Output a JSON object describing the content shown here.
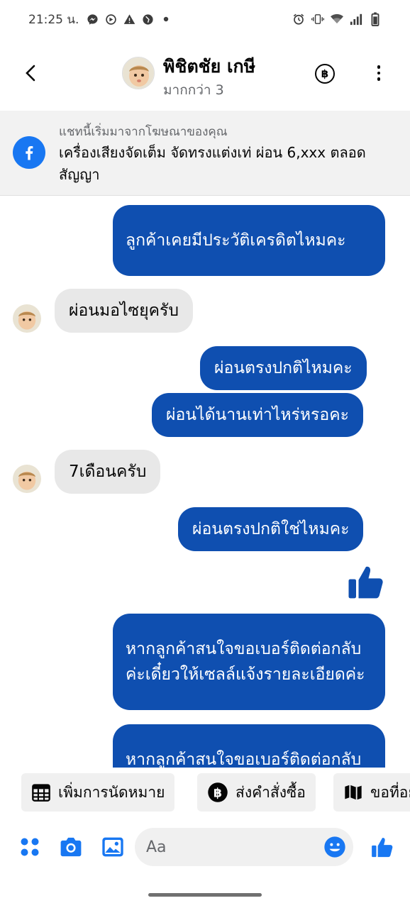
{
  "status_bar": {
    "time": "21:25 น.",
    "left_icons": [
      "messenger-icon",
      "compass-icon",
      "warning-icon",
      "globe-icon",
      "dot-icon"
    ],
    "right_icons": [
      "alarm-icon",
      "vibrate-icon",
      "wifi-icon",
      "signal-icon",
      "battery-icon"
    ]
  },
  "header": {
    "contact_name": "พิชิตชัย เกษี",
    "subtitle": "มากกว่า 3",
    "payment_symbol": "฿"
  },
  "ad_banner": {
    "caption": "แชทนี้เริ่มมาจากโฆษณาของคุณ",
    "ad_text": "เครื่องเสียงจัดเต็ม จัดทรงแต่งเท่ ผ่อน 6,xxx ตลอดสัญญา"
  },
  "messages": [
    {
      "from": "me",
      "text": "ลูกค้าเคยมีประวัติเครดิตไหมคะ"
    },
    {
      "from": "them",
      "text": "ผ่อนมอไซยุครับ"
    },
    {
      "from": "me",
      "text": "ผ่อนตรงปกติไหมคะ"
    },
    {
      "from": "me",
      "text": "ผ่อนได้นานเท่าไหร่หรอคะ"
    },
    {
      "from": "them",
      "text": "7เดือนครับ"
    },
    {
      "from": "me",
      "text": "ผ่อนตรงปกติใช่ไหมคะ"
    },
    {
      "from": "me",
      "type": "like",
      "icon": "thumbs-up-icon"
    },
    {
      "from": "me",
      "text": "หากลูกค้าสนใจขอเบอร์ติดต่อกลับค่ะเดี๋ยวให้เซลล์แจ้งรายละเอียดค่ะ"
    },
    {
      "from": "me",
      "text": "หากลูกค้าสนใจขอเบอร์ติดต่อกลับค่ะเดี๋ยวให้เซลล์แจ้งรายละเอียดค่ะ"
    }
  ],
  "quick_actions": [
    {
      "label": "เพิ่มการนัดหมาย",
      "icon": "calendar-icon"
    },
    {
      "label": "ส่งคำสั่งซื้อ",
      "icon": "baht-icon"
    },
    {
      "label": "ขอที่อยู่",
      "icon": "map-icon"
    }
  ],
  "composer": {
    "placeholder": "Aa",
    "icons": [
      "menu-dots-icon",
      "camera-icon",
      "gallery-icon",
      "emoji-icon",
      "like-icon"
    ]
  },
  "colors": {
    "outgoing_bubble": "#0f4fb0",
    "incoming_bubble": "#e8e8e8",
    "accent": "#1877f2"
  }
}
